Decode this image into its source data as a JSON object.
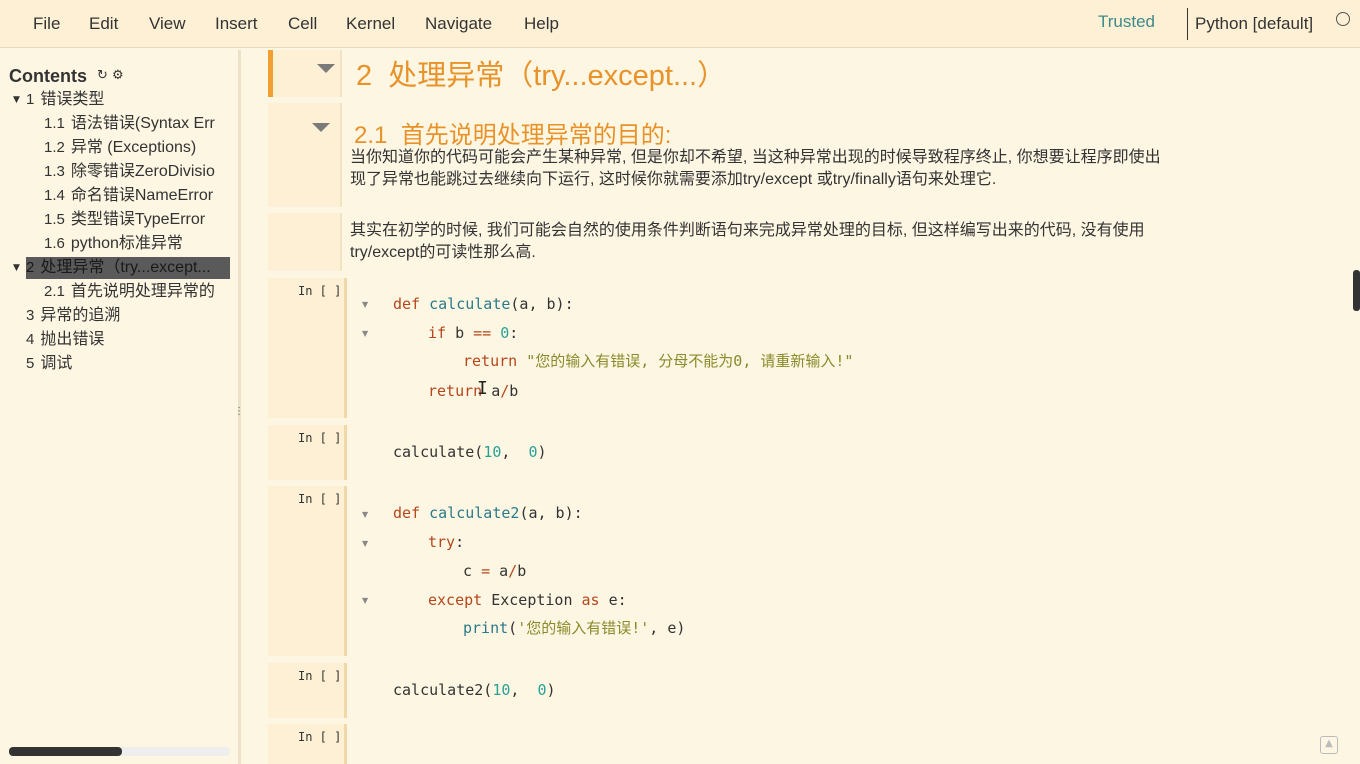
{
  "menubar": {
    "items": [
      "File",
      "Edit",
      "View",
      "Insert",
      "Cell",
      "Kernel",
      "Navigate",
      "Help"
    ],
    "trusted": "Trusted",
    "kernel": "Python [default]"
  },
  "toc": {
    "title": "Contents",
    "icons": "↻ ⚙",
    "items": [
      {
        "num": "1",
        "label": "错误类型"
      },
      {
        "num": "1.1",
        "label": "语法错误(Syntax Err"
      },
      {
        "num": "1.2",
        "label": "异常 (Exceptions)"
      },
      {
        "num": "1.3",
        "label": "除零错误ZeroDivisio"
      },
      {
        "num": "1.4",
        "label": "命名错误NameError"
      },
      {
        "num": "1.5",
        "label": "类型错误TypeError"
      },
      {
        "num": "1.6",
        "label": "python标准异常"
      },
      {
        "num": "2",
        "label": "处理异常（try...except..."
      },
      {
        "num": "2.1",
        "label": "首先说明处理异常的"
      },
      {
        "num": "3",
        "label": "异常的追溯"
      },
      {
        "num": "4",
        "label": "抛出错误"
      },
      {
        "num": "5",
        "label": "调试"
      }
    ]
  },
  "cells": {
    "h1": {
      "num": "2",
      "title": "处理异常（try...except...）"
    },
    "h2": {
      "num": "2.1",
      "title": "首先说明处理异常的目的:",
      "line1": "当你知道你的代码可能会产生某种异常, 但是你却不希望, 当这种异常出现的时候导致程序终止, 你想要让程序即使出",
      "line2": "现了异常也能跳过去继续向下运行, 这时候你就需要添加try/except 或try/finally语句来处理它."
    },
    "md3": {
      "line1": "其实在初学的时候, 我们可能会自然的使用条件判断语句来完成异常处理的目标, 但这样编写出来的代码, 没有使用",
      "line2": "try/except的可读性那么高."
    },
    "prompt": "In [ ]:",
    "code1": {
      "l1_kw": "def",
      "l1_fn": "calculate",
      "l1_rest": "(a, b):",
      "l2_kw": "if",
      "l2_a": " b ",
      "l2_op": "==",
      "l2_sp": " ",
      "l2_num": "0",
      "l2_end": ":",
      "l3_kw": "return",
      "l3_str": " \"您的输入有错误, 分母不能为0, 请重新输入!\"",
      "l4_kw": "return",
      "l4_a": " a",
      "l4_op": "/",
      "l4_b": "b"
    },
    "code2": {
      "a": "calculate(",
      "n1": "10",
      "mid": ",  ",
      "n2": "0",
      "end": ")"
    },
    "code3": {
      "l1_kw": "def",
      "l1_fn": "calculate2",
      "l1_rest": "(a, b):",
      "l2_kw": "try",
      "l2_end": ":",
      "l3_a": "c ",
      "l3_op1": "=",
      "l3_b": " a",
      "l3_op2": "/",
      "l3_c": "b",
      "l4_kw1": "except",
      "l4_a": " Exception ",
      "l4_kw2": "as",
      "l4_b": " e:",
      "l5_fn": "print",
      "l5_a": "(",
      "l5_str": "'您的输入有错误!'",
      "l5_b": ", e)"
    },
    "code4": {
      "a": "calculate2(",
      "n1": "10",
      "mid": ",  ",
      "n2": "0",
      "end": ")"
    }
  }
}
